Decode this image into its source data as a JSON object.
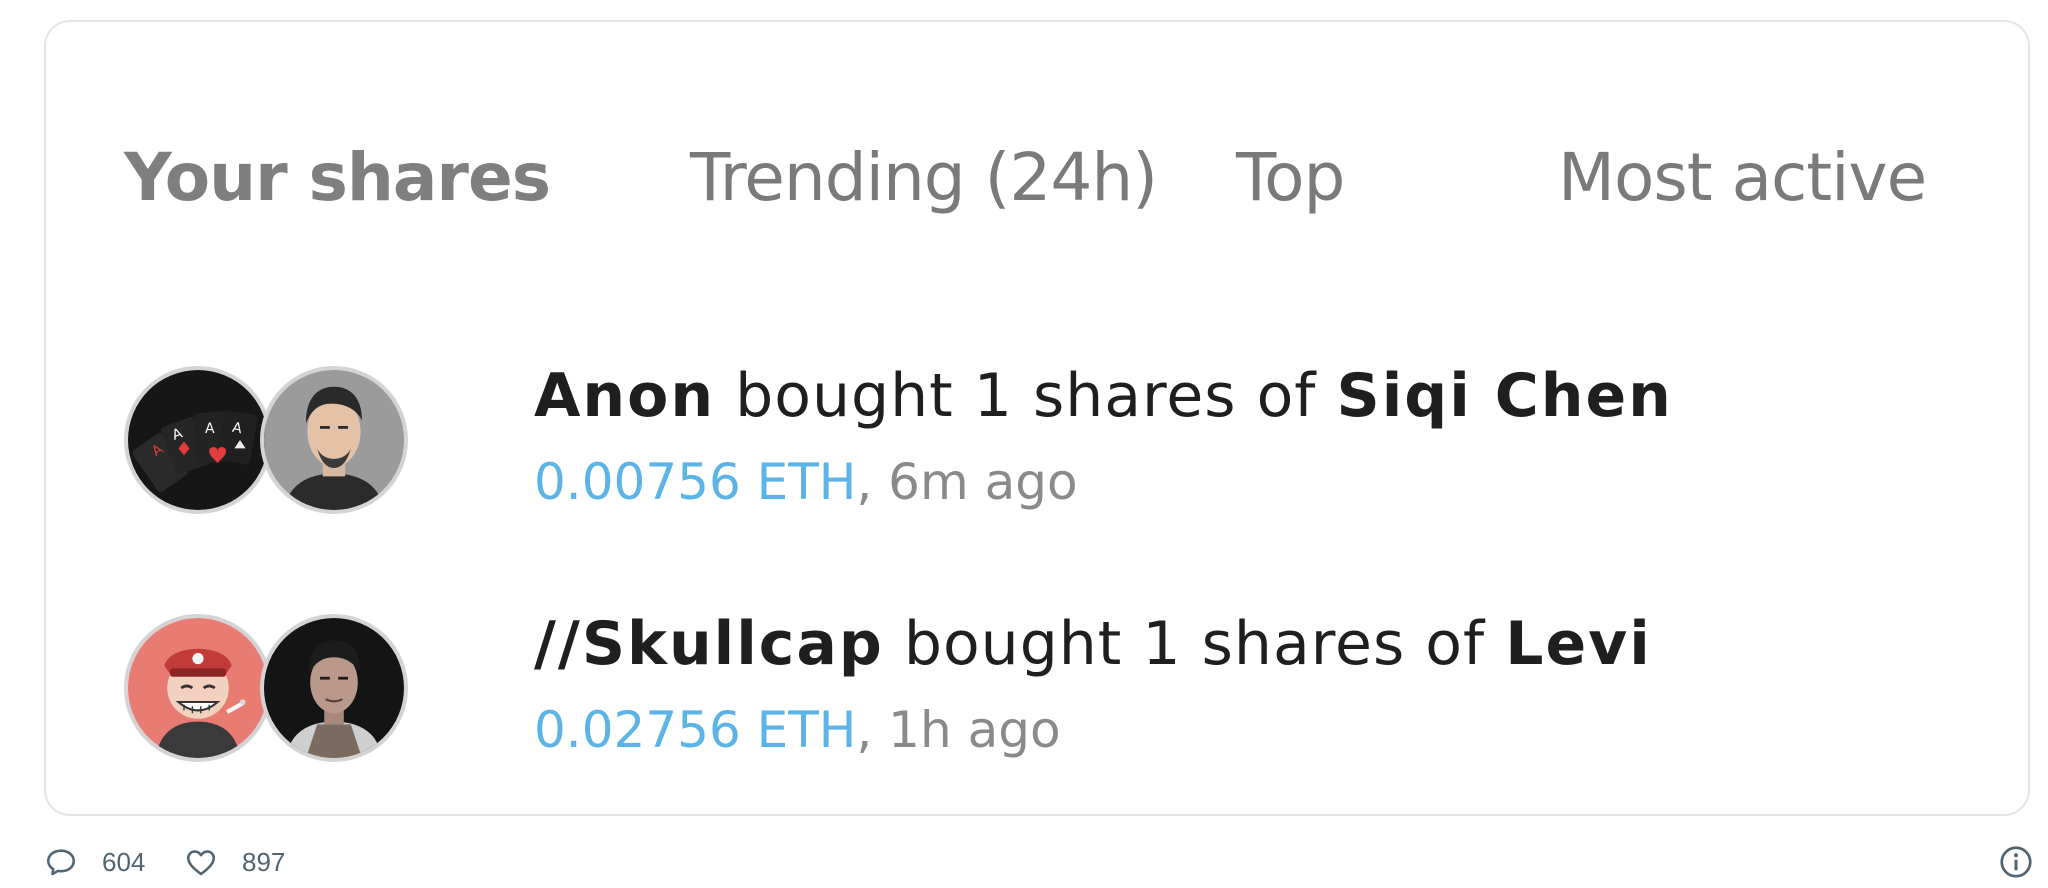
{
  "tabs": [
    {
      "label": "Your shares",
      "active": true
    },
    {
      "label": "Trending (24h)",
      "active": false
    },
    {
      "label": "Top",
      "active": false
    },
    {
      "label": "Most active",
      "active": false
    }
  ],
  "trades": [
    {
      "buyer": "Anon",
      "action": "bought 1 shares of",
      "subject": "Siqi Chen",
      "amount": "0.00756 ETH",
      "time": ", 6m ago",
      "buyer_avatar": "playing-cards-avatar",
      "subject_avatar": "man-portrait-avatar"
    },
    {
      "buyer": "//Skullcap",
      "action": "bought 1 shares of",
      "subject": "Levi",
      "amount": "0.02756 ETH",
      "time": ", 1h ago",
      "buyer_avatar": "cartoon-character-avatar",
      "subject_avatar": "man-portrait-avatar"
    }
  ],
  "footer": {
    "replies": "604",
    "likes": "897",
    "reply_icon": "comment-bubble-icon",
    "like_icon": "heart-icon",
    "info_icon": "info-icon"
  },
  "colors": {
    "accent": "#5bb4e5",
    "tab_text": "#7a7a7a",
    "primary_text": "#1f1f1f",
    "muted_text": "#8a8a8a",
    "border": "#e3e6e9"
  }
}
